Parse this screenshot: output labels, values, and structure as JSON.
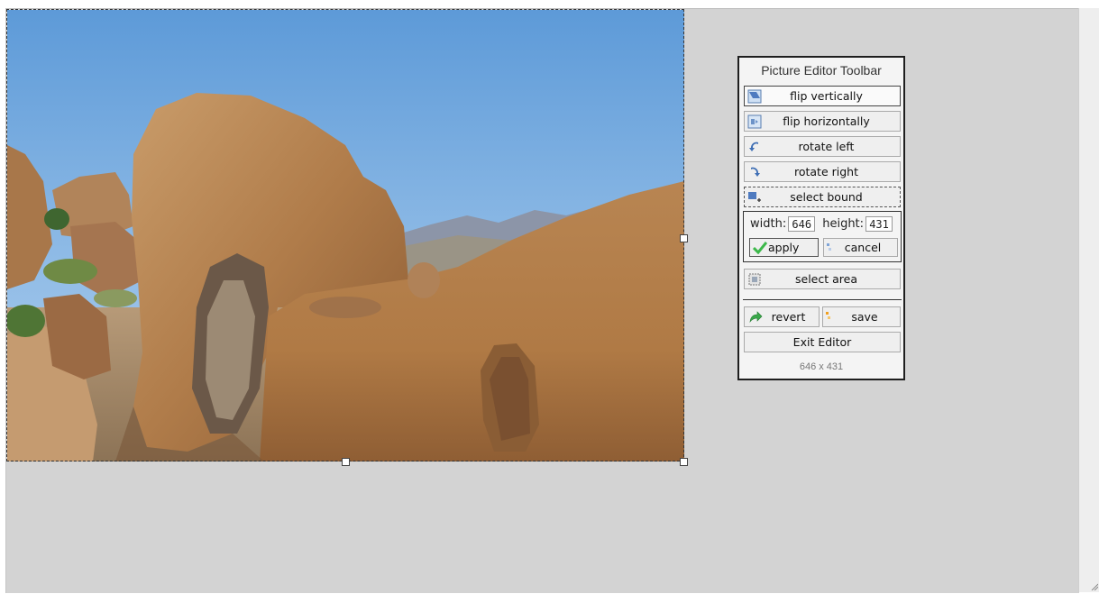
{
  "toolbar": {
    "title": "Picture Editor Toolbar",
    "flip_vertically": "flip vertically",
    "flip_horizontally": "flip horizontally",
    "rotate_left": "rotate left",
    "rotate_right": "rotate right",
    "select_bound": "select bound",
    "width_label": "width:",
    "width_value": "646",
    "height_label": "height:",
    "height_value": "431",
    "apply": "apply",
    "cancel": "cancel",
    "select_area": "select area",
    "revert": "revert",
    "save": "save",
    "exit": "Exit Editor",
    "size_readout": "646 x 431"
  },
  "icons": {
    "flip_vertically": "flip-vertical-icon",
    "flip_horizontally": "flip-horizontal-icon",
    "rotate_left": "rotate-left-icon",
    "rotate_right": "rotate-right-icon",
    "select_bound": "select-bound-icon",
    "apply": "checkmark-icon",
    "cancel": "cancel-icon",
    "select_area": "select-area-icon",
    "revert": "revert-arrow-icon",
    "save": "save-icon"
  },
  "colors": {
    "workspace": "#d3d3d3",
    "toolbar_border": "#1e1e1e",
    "apply_check": "#3cb84a",
    "revert_arrow": "#3aa84a"
  }
}
